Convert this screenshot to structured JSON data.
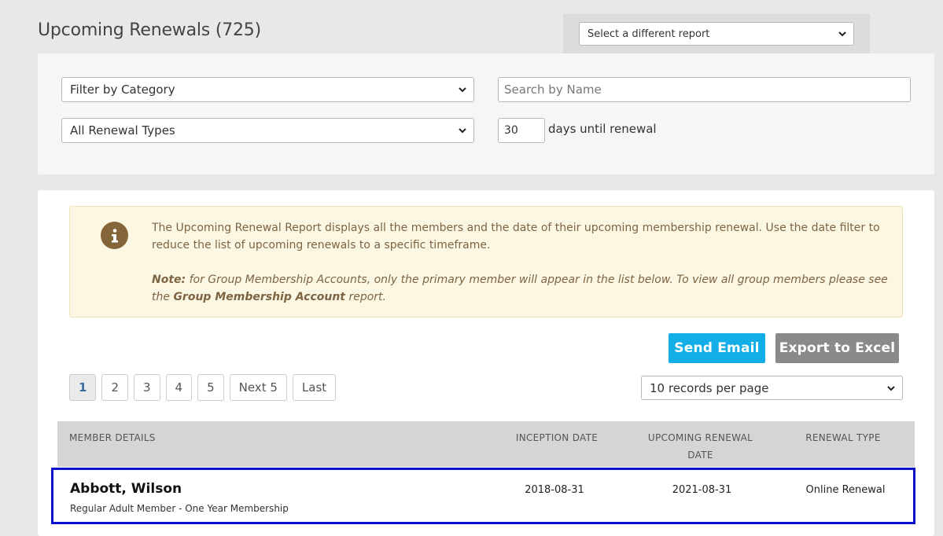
{
  "header": {
    "title": "Upcoming Renewals (725)",
    "report_select": "Select a different report"
  },
  "filters": {
    "category": "Filter by Category",
    "search_placeholder": "Search by Name",
    "renewal_types": "All Renewal Types",
    "days_value": "30",
    "days_label": "days until renewal"
  },
  "info": {
    "text": "The Upcoming Renewal Report displays all the members and the date of their upcoming membership renewal. Use the date filter to reduce the list of upcoming renewals to a specific timeframe.",
    "note_label": "Note:",
    "note_text": " for Group Membership Accounts, only the primary member will appear in the list below. To view all group members please see the ",
    "note_link": "Group Membership Account",
    "note_end": " report."
  },
  "actions": {
    "send_email": "Send Email",
    "export": "Export to Excel"
  },
  "pagination": {
    "pages": [
      "1",
      "2",
      "3",
      "4",
      "5"
    ],
    "next": "Next 5",
    "last": "Last",
    "per_page": "10 records per page"
  },
  "table": {
    "headers": {
      "member": "MEMBER DETAILS",
      "inception": "INCEPTION DATE",
      "renewal_line1": "UPCOMING RENEWAL",
      "renewal_line2": "DATE",
      "type": "RENEWAL TYPE"
    },
    "rows": [
      {
        "name": "Abbott, Wilson",
        "membership": "Regular Adult Member - One Year Membership",
        "inception": "2018-08-31",
        "renewal": "2021-08-31",
        "type": "Online Renewal"
      }
    ]
  },
  "colors": {
    "send_email": "#13aee8",
    "export": "#8a8a8a",
    "highlight_border": "#0c12c9",
    "info_bg": "#fcf7e3",
    "info_icon": "#85653a"
  }
}
